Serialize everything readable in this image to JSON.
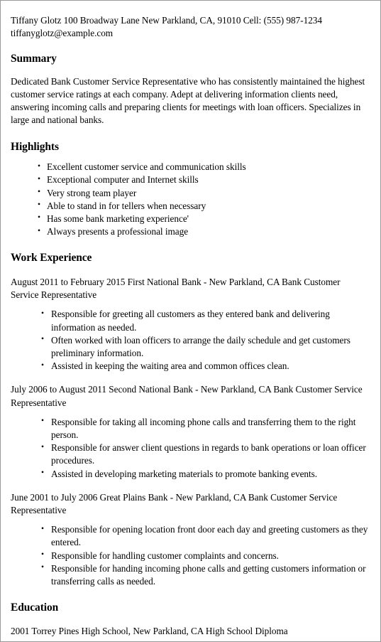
{
  "document": {
    "type": "resume",
    "contact": {
      "line1": "Tiffany Glotz 100 Broadway Lane New Parkland, CA, 91010 Cell: (555) 987-1234",
      "line2": "tiffanyglotz@example.com"
    },
    "sections": {
      "summary": {
        "heading": "Summary",
        "text": "Dedicated Bank Customer Service Representative who has consistently maintained the highest customer service ratings at each company. Adept at delivering information clients need, answering incoming calls and preparing clients for meetings with loan officers. Specializes in large and national banks."
      },
      "highlights": {
        "heading": "Highlights",
        "items": [
          "Excellent customer service and communication skills",
          "Exceptional computer and Internet skills",
          "Very strong team player",
          "Able to stand in for tellers when necessary",
          "Has some bank marketing experience'",
          "Always presents a professional image"
        ]
      },
      "work_experience": {
        "heading": "Work Experience",
        "jobs": [
          {
            "header": "August 2011 to February 2015 First National Bank - New Parkland, CA Bank Customer Service Representative",
            "duties": [
              "Responsible for greeting all customers as they entered bank and delivering information as needed.",
              "Often worked with loan officers to arrange the daily schedule and get customers preliminary information.",
              "Assisted in keeping the waiting area and common offices clean."
            ]
          },
          {
            "header": "July 2006 to August 2011 Second National Bank - New Parkland, CA Bank Customer Service Representative",
            "duties": [
              "Responsible for taking all incoming phone calls and transferring them to the right person.",
              "Responsible for answer client questions in regards to bank operations or loan officer procedures.",
              "Assisted in developing marketing materials to promote banking events."
            ]
          },
          {
            "header": "June 2001 to July 2006 Great Plains Bank - New Parkland, CA Bank Customer Service Representative",
            "duties": [
              "Responsible for opening location front door each day and greeting customers as they entered.",
              "Responsible for handling customer complaints and concerns.",
              "Responsible for handing incoming phone calls and getting customers information or transferring calls as needed."
            ]
          }
        ]
      },
      "education": {
        "heading": "Education",
        "entry": "2001 Torrey Pines High School, New Parkland, CA High School Diploma"
      }
    }
  },
  "colors": {
    "page_background": "#ffffff",
    "text": "#000000",
    "border": "#999999"
  }
}
